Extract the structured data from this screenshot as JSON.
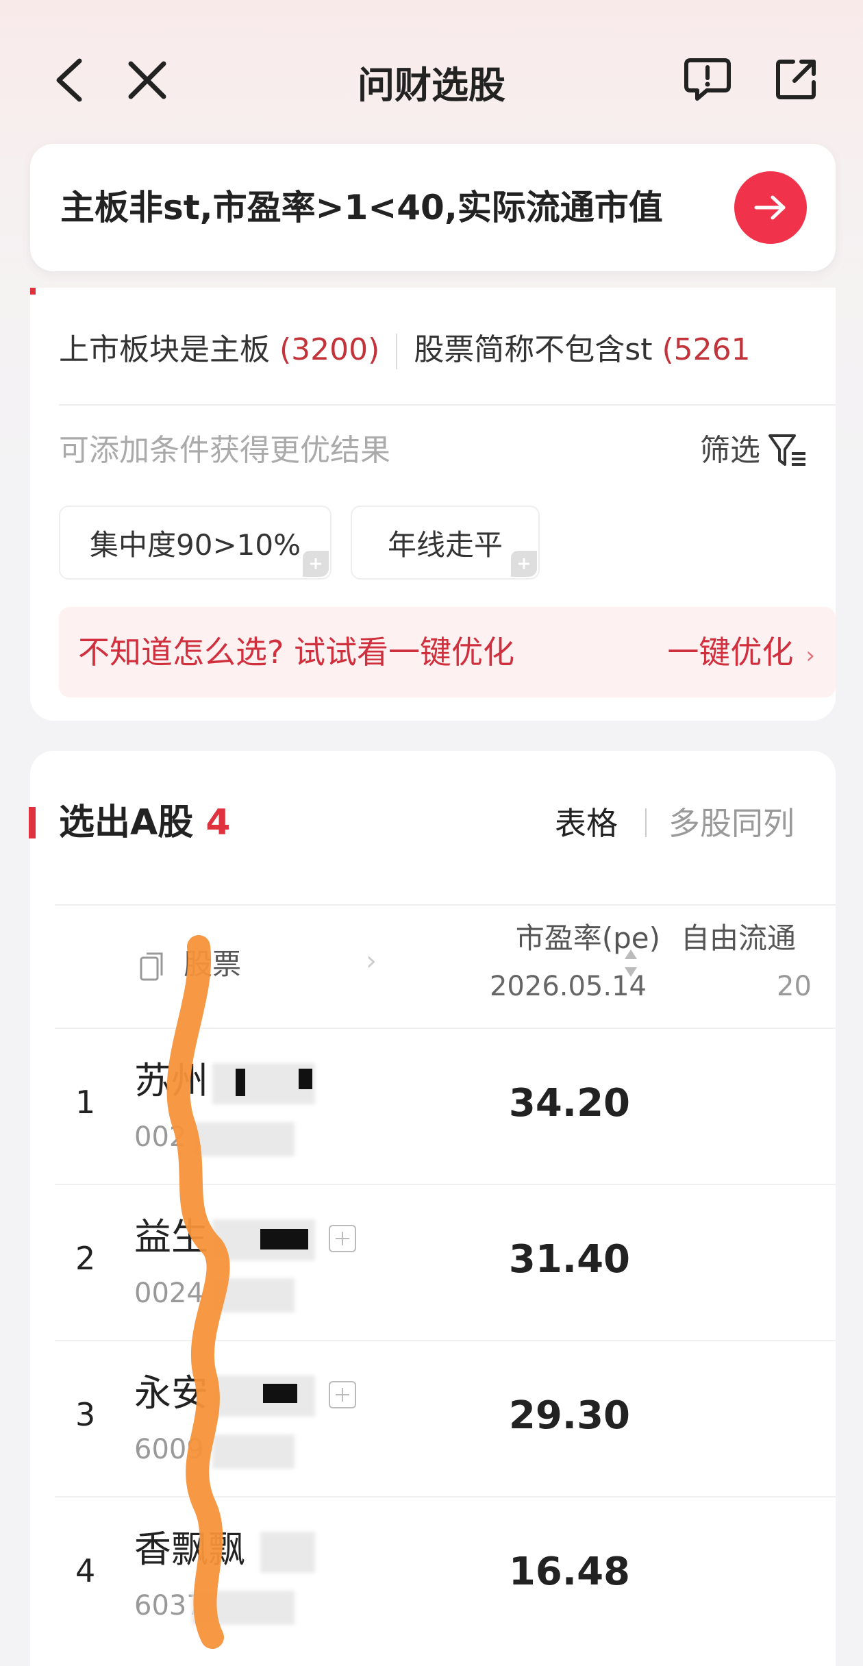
{
  "nav": {
    "title": "问财选股"
  },
  "query": {
    "text": "主板非st,市盈率>1<40,实际流通市值"
  },
  "conditions": {
    "items": [
      {
        "label": "上市板块是主板",
        "count": "(3200)"
      },
      {
        "label": "股票简称不包含st",
        "count": "(5261"
      }
    ],
    "hint": "可添加条件获得更优结果",
    "filter_label": "筛选",
    "chips": [
      "集中度90>10%",
      "年线走平"
    ],
    "optimize_text": "不知道怎么选? 试试看一键优化",
    "optimize_button": "一键优化"
  },
  "results": {
    "title": "选出A股",
    "count": "4",
    "views": [
      "表格",
      "多股同列"
    ],
    "columns": {
      "stock": "股票",
      "pe": "市盈率(pe)",
      "pe_date": "2026.05.14",
      "free_float": "自由流通",
      "free_float_date": "20"
    },
    "rows": [
      {
        "index": "1",
        "name": "苏州",
        "code": "002",
        "pe": "34.20"
      },
      {
        "index": "2",
        "name": "益生",
        "code": "0024",
        "pe": "31.40"
      },
      {
        "index": "3",
        "name": "永安",
        "code": "6009",
        "pe": "29.30"
      },
      {
        "index": "4",
        "name": "香飘飘",
        "code": "6037",
        "pe": "16.48"
      }
    ]
  },
  "colors": {
    "accent": "#f0334b",
    "count_red": "#c2333a",
    "annotation_orange": "#f5923a"
  }
}
